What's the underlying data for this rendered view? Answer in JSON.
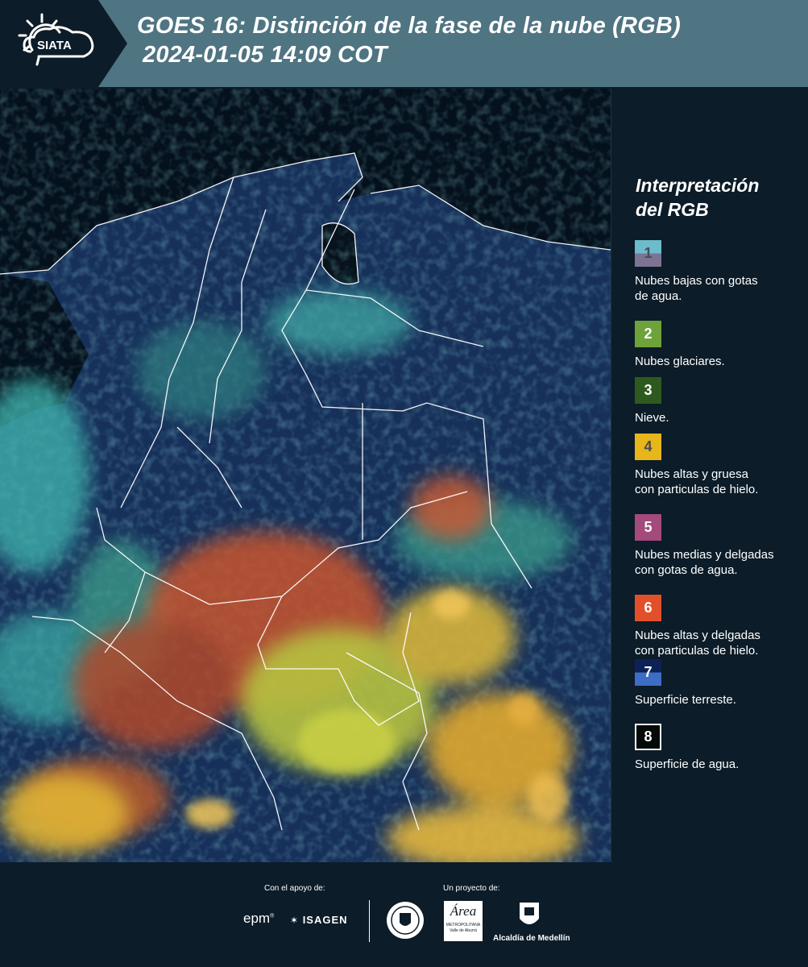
{
  "header": {
    "logo_text": "SIATA",
    "title_line1": "GOES 16: Distinción de la fase de la nube (RGB)",
    "title_line2": "2024-01-05 14:09 COT"
  },
  "map": {
    "content": "satellite-rgb-composite",
    "colors": {
      "water": "#04111d",
      "land": "#17315c",
      "low_cloud": "#5dc9c6",
      "glacial": "#6aa13a",
      "high_thick_ice": "#e3b12a",
      "high_thin_ice": "#e06a3a",
      "borders": "#ffffff"
    }
  },
  "legend": {
    "title_line1": "Interpretación",
    "title_line2": "del RGB",
    "items": [
      {
        "num": "1",
        "label_line1": "Nubes bajas con gotas",
        "label_line2": "de agua.",
        "color_top": "#6cbccb",
        "color_bottom": "#7d7494",
        "text_color": "#4a4a5a"
      },
      {
        "num": "2",
        "label_line1": "Nubes glaciares.",
        "label_line2": "",
        "color_top": "#6ea23b",
        "color_bottom": "#6ea23b",
        "text_color": "#ffffff"
      },
      {
        "num": "3",
        "label_line1": "Nieve.",
        "label_line2": "",
        "color_top": "#2f5a1f",
        "color_bottom": "#2f5a1f",
        "text_color": "#ffffff"
      },
      {
        "num": "4",
        "label_line1": "Nubes altas y gruesa",
        "label_line2": "con particulas de hielo.",
        "color_top": "#e6b61b",
        "color_bottom": "#e6b61b",
        "text_color": "#4a4a4a"
      },
      {
        "num": "5",
        "label_line1": "Nubes medias y delgadas",
        "label_line2": "con gotas de agua.",
        "color_top": "#a44a7c",
        "color_bottom": "#a44a7c",
        "text_color": "#ffffff"
      },
      {
        "num": "6",
        "label_line1": "Nubes altas y delgadas",
        "label_line2": "con particulas de hielo.",
        "color_top": "#e2502b",
        "color_bottom": "#e2502b",
        "text_color": "#ffffff"
      },
      {
        "num": "7",
        "label_line1": "Superficie terreste.",
        "label_line2": "",
        "color_top": "#0e2157",
        "color_bottom": "#3d6dc4",
        "text_color": "#ffffff"
      },
      {
        "num": "8",
        "label_line1": "Superficie de agua.",
        "label_line2": "",
        "color_top": "#040a08",
        "color_bottom": "#040a08",
        "text_color": "#ffffff",
        "border": "#ffffff"
      }
    ]
  },
  "footer": {
    "support_label": "Con el apoyo de:",
    "project_label": "Un proyecto de:",
    "epm": "epm",
    "isagen": "ISAGEN",
    "area_title": "Área",
    "area_line1": "METROPOLITANA",
    "area_line2": "Valle de Aburrá",
    "alcaldia": "Alcaldía de Medellín"
  }
}
